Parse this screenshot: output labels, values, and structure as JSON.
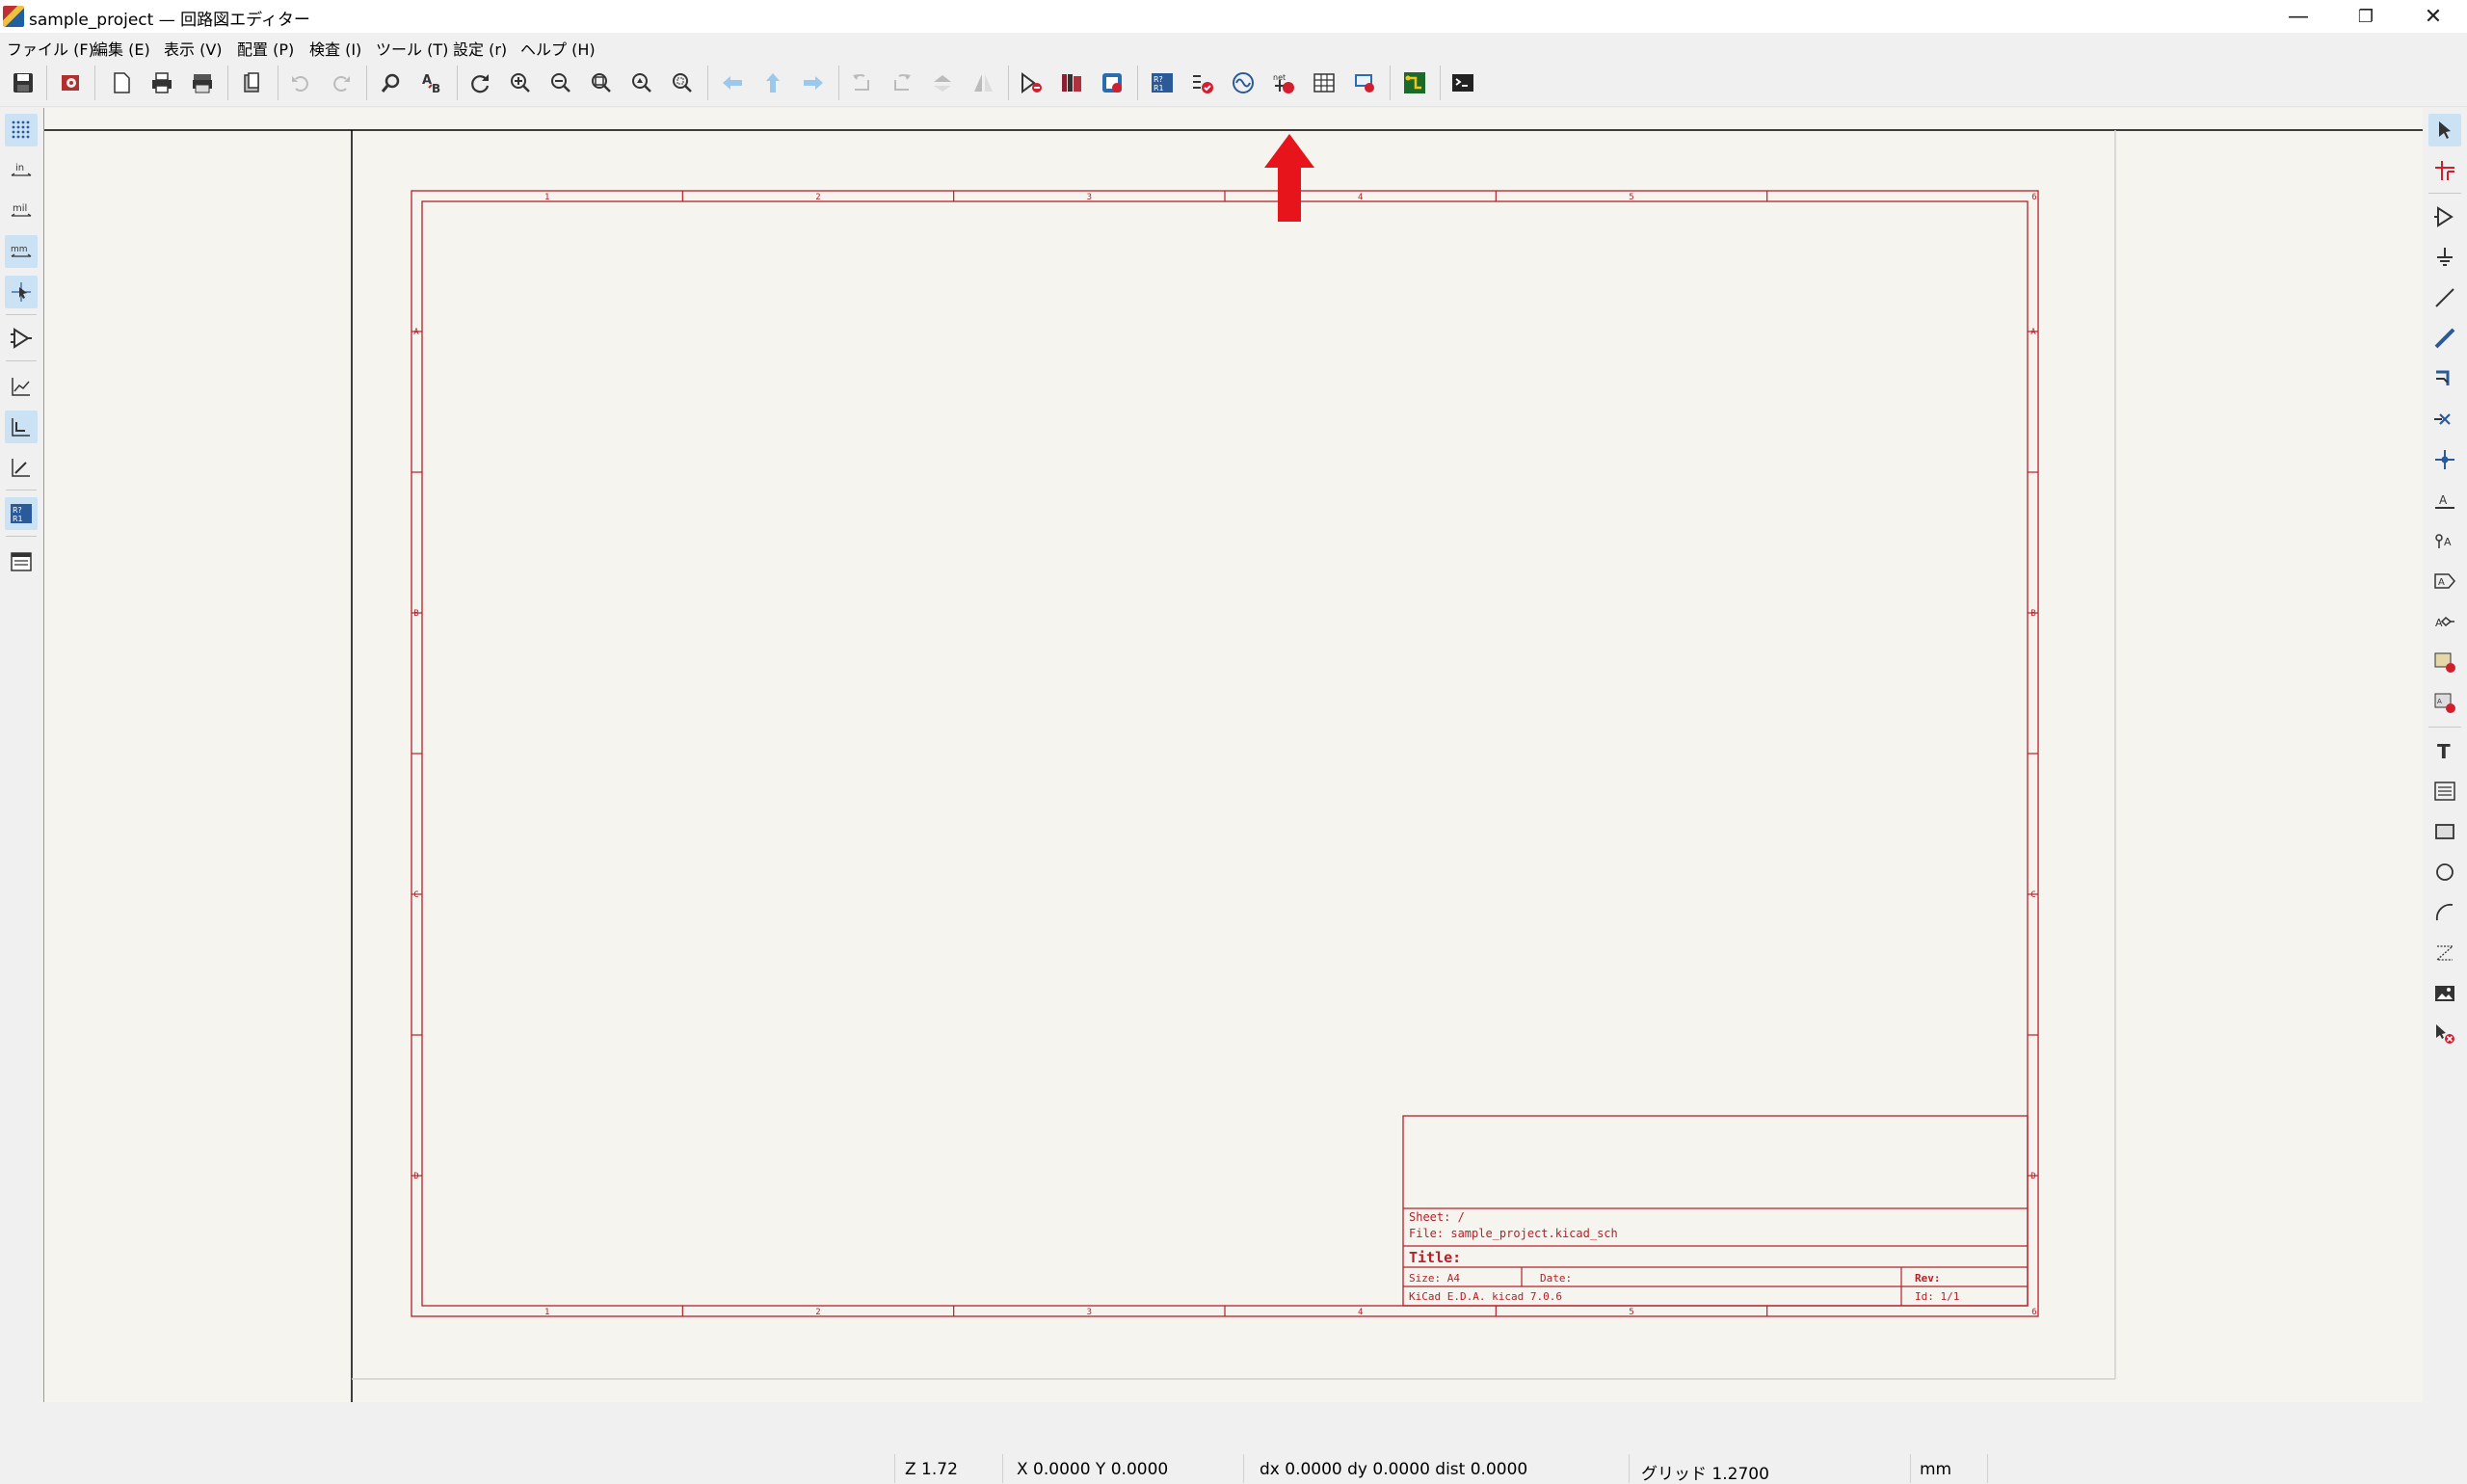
{
  "window": {
    "title": "sample_project — 回路図エディター",
    "minimize_glyph": "—",
    "restore_glyph": "❐",
    "close_glyph": "✕"
  },
  "menu": [
    {
      "label": "ファイル (F)"
    },
    {
      "label": "編集 (E)"
    },
    {
      "label": "表示 (V)"
    },
    {
      "label": "配置 (P)"
    },
    {
      "label": "検査 (I)"
    },
    {
      "label": "ツール (T)"
    },
    {
      "label": "設定 (r)"
    },
    {
      "label": "ヘルプ (H)"
    }
  ],
  "left_toolbar": {
    "units_in": "in",
    "units_mil": "mil",
    "units_mm": "mm"
  },
  "sheet": {
    "col_labels": [
      "1",
      "2",
      "3",
      "4",
      "5",
      "6"
    ],
    "row_labels": [
      "A",
      "B",
      "C",
      "D"
    ],
    "title_block": {
      "sheet": "Sheet: /",
      "file": "File: sample_project.kicad_sch",
      "title": "Title:",
      "size": "Size: A4",
      "date": "Date:",
      "rev": "Rev:",
      "tool": "KiCad E.D.A.  kicad 7.0.6",
      "id": "Id: 1/1"
    },
    "line_color": "#b5202b"
  },
  "annotation": {
    "arrow_color": "#e8141b"
  },
  "status": {
    "zoom": "Z 1.72",
    "xy": "X 0.0000  Y 0.0000",
    "delta": "dx 0.0000  dy 0.0000  dist 0.0000",
    "grid": "グリッド 1.2700",
    "units": "mm"
  }
}
